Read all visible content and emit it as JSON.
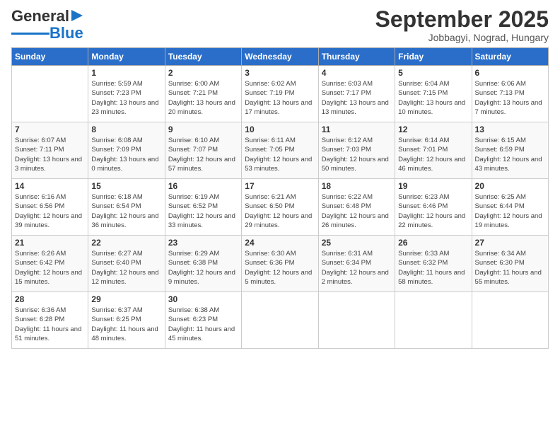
{
  "header": {
    "logo_general": "General",
    "logo_blue": "Blue",
    "title": "September 2025",
    "subtitle": "Jobbagyi, Nograd, Hungary"
  },
  "days_of_week": [
    "Sunday",
    "Monday",
    "Tuesday",
    "Wednesday",
    "Thursday",
    "Friday",
    "Saturday"
  ],
  "weeks": [
    [
      {
        "day": "",
        "sunrise": "",
        "sunset": "",
        "daylight": ""
      },
      {
        "day": "1",
        "sunrise": "Sunrise: 5:59 AM",
        "sunset": "Sunset: 7:23 PM",
        "daylight": "Daylight: 13 hours and 23 minutes."
      },
      {
        "day": "2",
        "sunrise": "Sunrise: 6:00 AM",
        "sunset": "Sunset: 7:21 PM",
        "daylight": "Daylight: 13 hours and 20 minutes."
      },
      {
        "day": "3",
        "sunrise": "Sunrise: 6:02 AM",
        "sunset": "Sunset: 7:19 PM",
        "daylight": "Daylight: 13 hours and 17 minutes."
      },
      {
        "day": "4",
        "sunrise": "Sunrise: 6:03 AM",
        "sunset": "Sunset: 7:17 PM",
        "daylight": "Daylight: 13 hours and 13 minutes."
      },
      {
        "day": "5",
        "sunrise": "Sunrise: 6:04 AM",
        "sunset": "Sunset: 7:15 PM",
        "daylight": "Daylight: 13 hours and 10 minutes."
      },
      {
        "day": "6",
        "sunrise": "Sunrise: 6:06 AM",
        "sunset": "Sunset: 7:13 PM",
        "daylight": "Daylight: 13 hours and 7 minutes."
      }
    ],
    [
      {
        "day": "7",
        "sunrise": "Sunrise: 6:07 AM",
        "sunset": "Sunset: 7:11 PM",
        "daylight": "Daylight: 13 hours and 3 minutes."
      },
      {
        "day": "8",
        "sunrise": "Sunrise: 6:08 AM",
        "sunset": "Sunset: 7:09 PM",
        "daylight": "Daylight: 13 hours and 0 minutes."
      },
      {
        "day": "9",
        "sunrise": "Sunrise: 6:10 AM",
        "sunset": "Sunset: 7:07 PM",
        "daylight": "Daylight: 12 hours and 57 minutes."
      },
      {
        "day": "10",
        "sunrise": "Sunrise: 6:11 AM",
        "sunset": "Sunset: 7:05 PM",
        "daylight": "Daylight: 12 hours and 53 minutes."
      },
      {
        "day": "11",
        "sunrise": "Sunrise: 6:12 AM",
        "sunset": "Sunset: 7:03 PM",
        "daylight": "Daylight: 12 hours and 50 minutes."
      },
      {
        "day": "12",
        "sunrise": "Sunrise: 6:14 AM",
        "sunset": "Sunset: 7:01 PM",
        "daylight": "Daylight: 12 hours and 46 minutes."
      },
      {
        "day": "13",
        "sunrise": "Sunrise: 6:15 AM",
        "sunset": "Sunset: 6:59 PM",
        "daylight": "Daylight: 12 hours and 43 minutes."
      }
    ],
    [
      {
        "day": "14",
        "sunrise": "Sunrise: 6:16 AM",
        "sunset": "Sunset: 6:56 PM",
        "daylight": "Daylight: 12 hours and 39 minutes."
      },
      {
        "day": "15",
        "sunrise": "Sunrise: 6:18 AM",
        "sunset": "Sunset: 6:54 PM",
        "daylight": "Daylight: 12 hours and 36 minutes."
      },
      {
        "day": "16",
        "sunrise": "Sunrise: 6:19 AM",
        "sunset": "Sunset: 6:52 PM",
        "daylight": "Daylight: 12 hours and 33 minutes."
      },
      {
        "day": "17",
        "sunrise": "Sunrise: 6:21 AM",
        "sunset": "Sunset: 6:50 PM",
        "daylight": "Daylight: 12 hours and 29 minutes."
      },
      {
        "day": "18",
        "sunrise": "Sunrise: 6:22 AM",
        "sunset": "Sunset: 6:48 PM",
        "daylight": "Daylight: 12 hours and 26 minutes."
      },
      {
        "day": "19",
        "sunrise": "Sunrise: 6:23 AM",
        "sunset": "Sunset: 6:46 PM",
        "daylight": "Daylight: 12 hours and 22 minutes."
      },
      {
        "day": "20",
        "sunrise": "Sunrise: 6:25 AM",
        "sunset": "Sunset: 6:44 PM",
        "daylight": "Daylight: 12 hours and 19 minutes."
      }
    ],
    [
      {
        "day": "21",
        "sunrise": "Sunrise: 6:26 AM",
        "sunset": "Sunset: 6:42 PM",
        "daylight": "Daylight: 12 hours and 15 minutes."
      },
      {
        "day": "22",
        "sunrise": "Sunrise: 6:27 AM",
        "sunset": "Sunset: 6:40 PM",
        "daylight": "Daylight: 12 hours and 12 minutes."
      },
      {
        "day": "23",
        "sunrise": "Sunrise: 6:29 AM",
        "sunset": "Sunset: 6:38 PM",
        "daylight": "Daylight: 12 hours and 9 minutes."
      },
      {
        "day": "24",
        "sunrise": "Sunrise: 6:30 AM",
        "sunset": "Sunset: 6:36 PM",
        "daylight": "Daylight: 12 hours and 5 minutes."
      },
      {
        "day": "25",
        "sunrise": "Sunrise: 6:31 AM",
        "sunset": "Sunset: 6:34 PM",
        "daylight": "Daylight: 12 hours and 2 minutes."
      },
      {
        "day": "26",
        "sunrise": "Sunrise: 6:33 AM",
        "sunset": "Sunset: 6:32 PM",
        "daylight": "Daylight: 11 hours and 58 minutes."
      },
      {
        "day": "27",
        "sunrise": "Sunrise: 6:34 AM",
        "sunset": "Sunset: 6:30 PM",
        "daylight": "Daylight: 11 hours and 55 minutes."
      }
    ],
    [
      {
        "day": "28",
        "sunrise": "Sunrise: 6:36 AM",
        "sunset": "Sunset: 6:28 PM",
        "daylight": "Daylight: 11 hours and 51 minutes."
      },
      {
        "day": "29",
        "sunrise": "Sunrise: 6:37 AM",
        "sunset": "Sunset: 6:25 PM",
        "daylight": "Daylight: 11 hours and 48 minutes."
      },
      {
        "day": "30",
        "sunrise": "Sunrise: 6:38 AM",
        "sunset": "Sunset: 6:23 PM",
        "daylight": "Daylight: 11 hours and 45 minutes."
      },
      {
        "day": "",
        "sunrise": "",
        "sunset": "",
        "daylight": ""
      },
      {
        "day": "",
        "sunrise": "",
        "sunset": "",
        "daylight": ""
      },
      {
        "day": "",
        "sunrise": "",
        "sunset": "",
        "daylight": ""
      },
      {
        "day": "",
        "sunrise": "",
        "sunset": "",
        "daylight": ""
      }
    ]
  ]
}
